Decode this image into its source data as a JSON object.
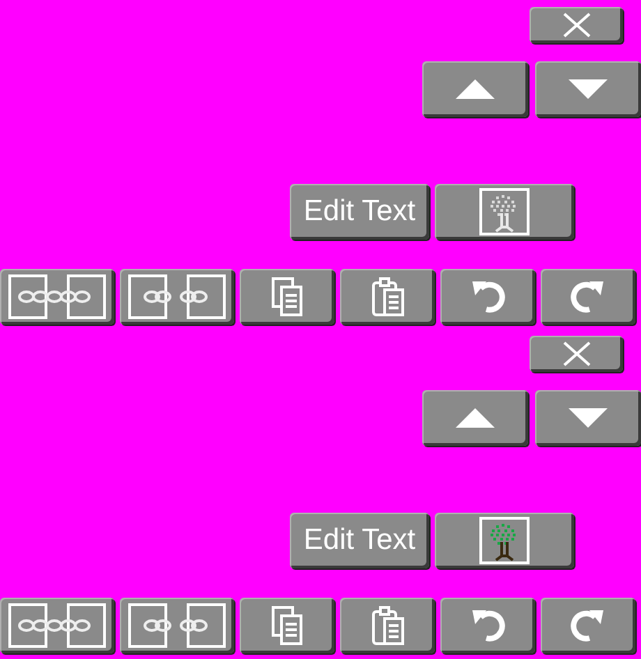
{
  "panels": [
    {
      "edit_label": "Edit Text",
      "tree_colored": false
    },
    {
      "edit_label": "Edit Text",
      "tree_colored": true
    }
  ]
}
